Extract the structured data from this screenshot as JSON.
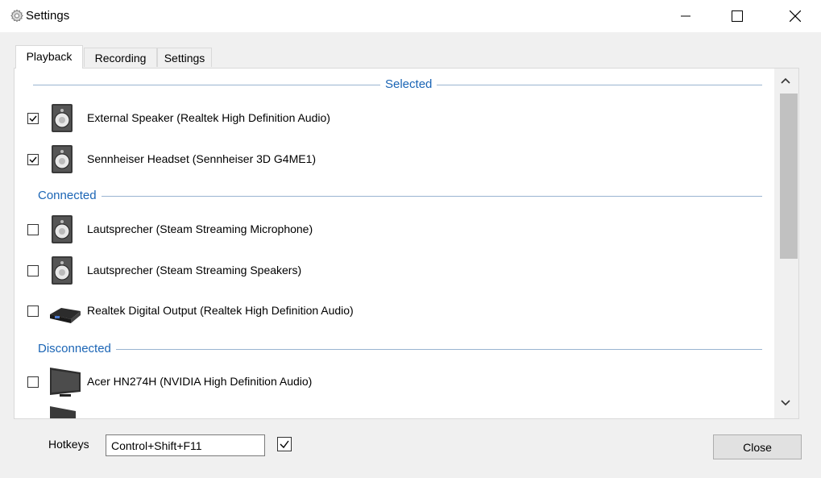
{
  "window": {
    "title": "Settings",
    "icon": "gear-icon"
  },
  "tabs": [
    {
      "label": "Playback",
      "active": true
    },
    {
      "label": "Recording",
      "active": false
    },
    {
      "label": "Settings",
      "active": false
    }
  ],
  "sections": {
    "selected": "Selected",
    "connected": "Connected",
    "disconnected": "Disconnected"
  },
  "devices": [
    {
      "label": "External Speaker (Realtek High Definition Audio)",
      "checked": true,
      "icon": "speaker-icon"
    },
    {
      "label": "Sennheiser Headset (Sennheiser 3D G4ME1)",
      "checked": true,
      "icon": "speaker-icon"
    },
    {
      "label": "Lautsprecher (Steam Streaming Microphone)",
      "checked": false,
      "icon": "speaker-icon"
    },
    {
      "label": "Lautsprecher (Steam Streaming Speakers)",
      "checked": false,
      "icon": "speaker-icon"
    },
    {
      "label": "Realtek Digital Output (Realtek High Definition Audio)",
      "checked": false,
      "icon": "digital-output-icon"
    },
    {
      "label": "Acer HN274H (NVIDIA High Definition Audio)",
      "checked": false,
      "icon": "monitor-icon"
    }
  ],
  "hotkeys": {
    "label": "Hotkeys",
    "value": "Control+Shift+F11",
    "enabled": true
  },
  "close_label": "Close",
  "colors": {
    "section_label": "#1b65b5",
    "separator": "#99b4d1"
  }
}
